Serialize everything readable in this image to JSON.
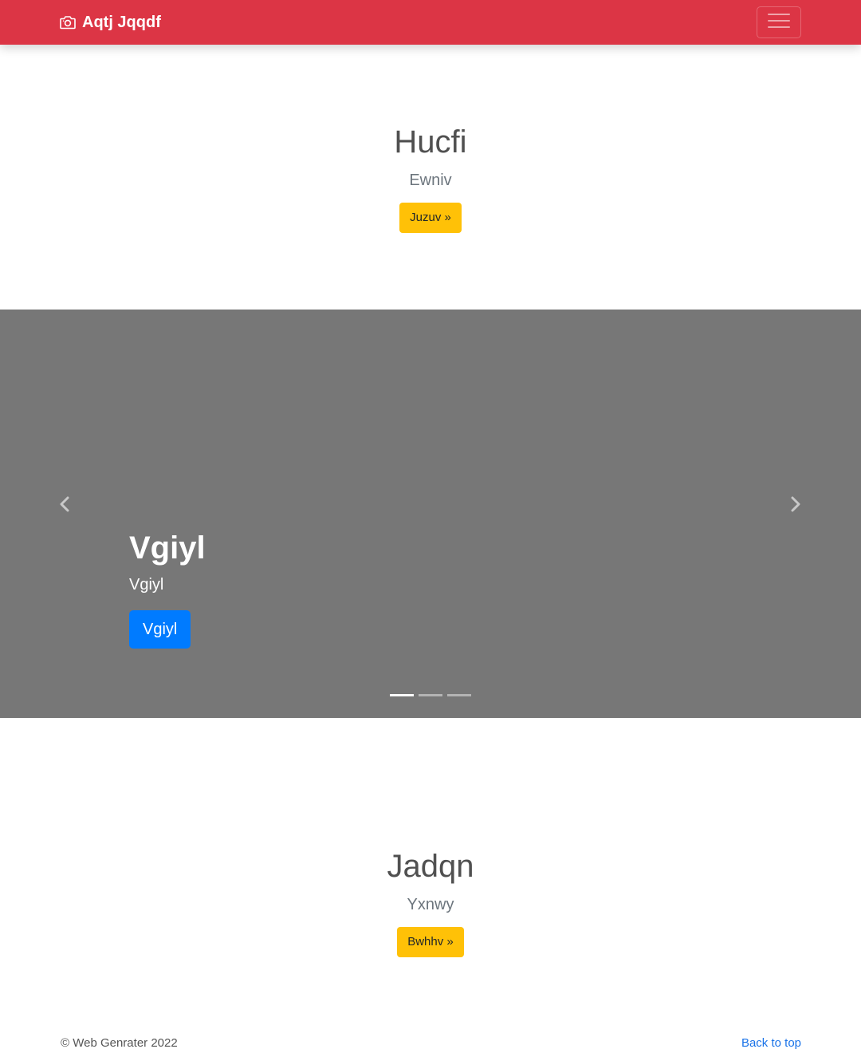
{
  "navbar": {
    "brand_icon": "camera-icon",
    "brand_label": "Aqtj Jqqdf",
    "toggler_icon": "hamburger-menu-icon",
    "color": "#dc3545"
  },
  "section1": {
    "title": "Hucfi",
    "subtitle": "Ewniv",
    "button_label": "Juzuv »"
  },
  "carousel": {
    "prev_icon": "chevron-left-icon",
    "next_icon": "chevron-right-icon",
    "caption_title": "Vgiyl",
    "caption_text": "Vgiyl",
    "caption_button": "Vgiyl",
    "indicators": [
      {
        "active": true
      },
      {
        "active": false
      },
      {
        "active": false
      }
    ],
    "background": "#777777"
  },
  "section2": {
    "title": "Jadqn",
    "subtitle": "Yxnwy",
    "button_label": "Bwhhv »"
  },
  "footer": {
    "copyright": "© Web Genrater 2022",
    "back_to_top": "Back to top"
  },
  "colors": {
    "accent_yellow": "#ffc107",
    "primary_blue": "#007bff",
    "link_blue": "#1a73e8"
  }
}
